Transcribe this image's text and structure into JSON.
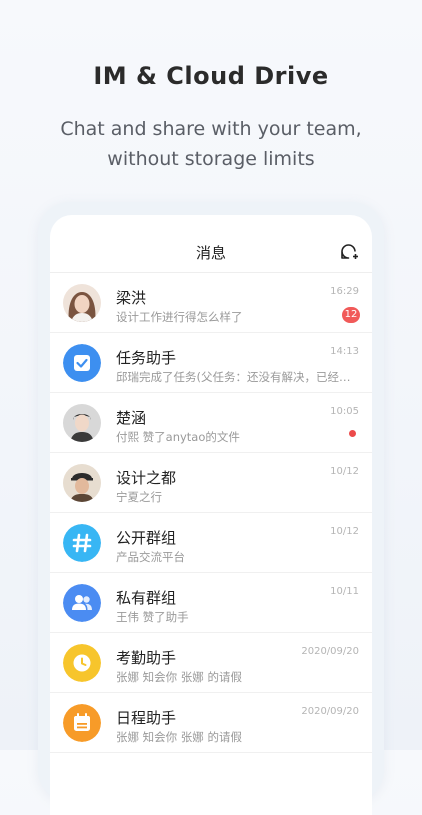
{
  "promo": {
    "headline": "IM & Cloud Drive",
    "subline_1": "Chat and share with your team,",
    "subline_2": "without storage limits"
  },
  "header": {
    "title": "消息",
    "new_chat_icon": "new-chat-icon"
  },
  "conversations": [
    {
      "name": "梁洪",
      "preview": "设计工作进行得怎么样了",
      "time": "16:29",
      "badge": "12",
      "avatar": "photo-woman",
      "color": "#e8c9b8"
    },
    {
      "name": "任务助手",
      "preview": "邱瑞完成了任务(父任务：还没有解决，已经…",
      "time": "14:13",
      "avatar": "check-icon",
      "color": "#3d8ff0"
    },
    {
      "name": "楚涵",
      "preview": "付熙 赞了anytao的文件",
      "time": "10:05",
      "dot": true,
      "avatar": "photo-man",
      "color": "#cfcfcf"
    },
    {
      "name": "设计之都",
      "preview": "宁夏之行",
      "time": "10/12",
      "avatar": "photo-man-hat",
      "color": "#d9c7b0"
    },
    {
      "name": "公开群组",
      "preview": "产品交流平台",
      "time": "10/12",
      "avatar": "hash-icon",
      "color": "#38b6f4"
    },
    {
      "name": "私有群组",
      "preview": "王伟 赞了助手",
      "time": "10/11",
      "avatar": "people-icon",
      "color": "#4b8cf2"
    },
    {
      "name": "考勤助手",
      "preview": "张娜 知会你 张娜 的请假",
      "time": "2020/09/20",
      "avatar": "clock-icon",
      "color": "#f7c52c"
    },
    {
      "name": "日程助手",
      "preview": "张娜 知会你 张娜 的请假",
      "time": "2020/09/20",
      "avatar": "calendar-icon",
      "color": "#f79b28"
    }
  ]
}
